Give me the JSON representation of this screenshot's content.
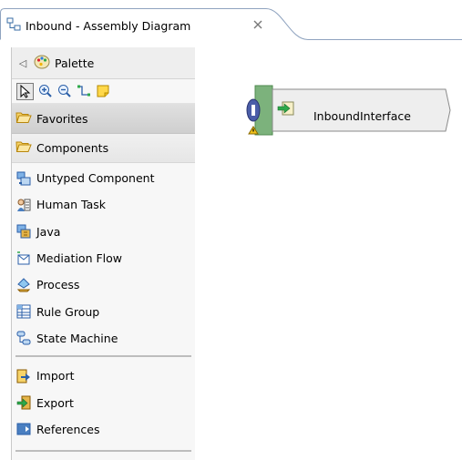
{
  "editor_tab": {
    "title": "Inbound - Assembly Diagram",
    "close_icon": "close-icon"
  },
  "palette": {
    "title": "Palette",
    "tools": [
      "select-arrow-icon",
      "zoom-in-icon",
      "zoom-out-icon",
      "wire-icon",
      "sticky-note-icon"
    ],
    "favorites_label": "Favorites",
    "components_label": "Components",
    "components": [
      {
        "label": "Untyped Component",
        "icon": "untyped-component-icon"
      },
      {
        "label": "Human Task",
        "icon": "human-task-icon"
      },
      {
        "label": "Java",
        "icon": "java-icon"
      },
      {
        "label": "Mediation Flow",
        "icon": "mediation-flow-icon"
      },
      {
        "label": "Process",
        "icon": "process-icon"
      },
      {
        "label": "Rule Group",
        "icon": "rule-group-icon"
      },
      {
        "label": "State Machine",
        "icon": "state-machine-icon"
      }
    ],
    "more": [
      {
        "label": "Import",
        "icon": "import-icon"
      },
      {
        "label": "Export",
        "icon": "export-icon"
      },
      {
        "label": "References",
        "icon": "references-icon"
      }
    ]
  },
  "diagram": {
    "export_node": {
      "label": "InboundInterface",
      "badge": "interface-badge-icon",
      "warning": "warning-icon"
    }
  },
  "colors": {
    "tab_border": "#8fa3bf",
    "node_green": "#7cb27c",
    "node_fill": "#eeeeee"
  }
}
